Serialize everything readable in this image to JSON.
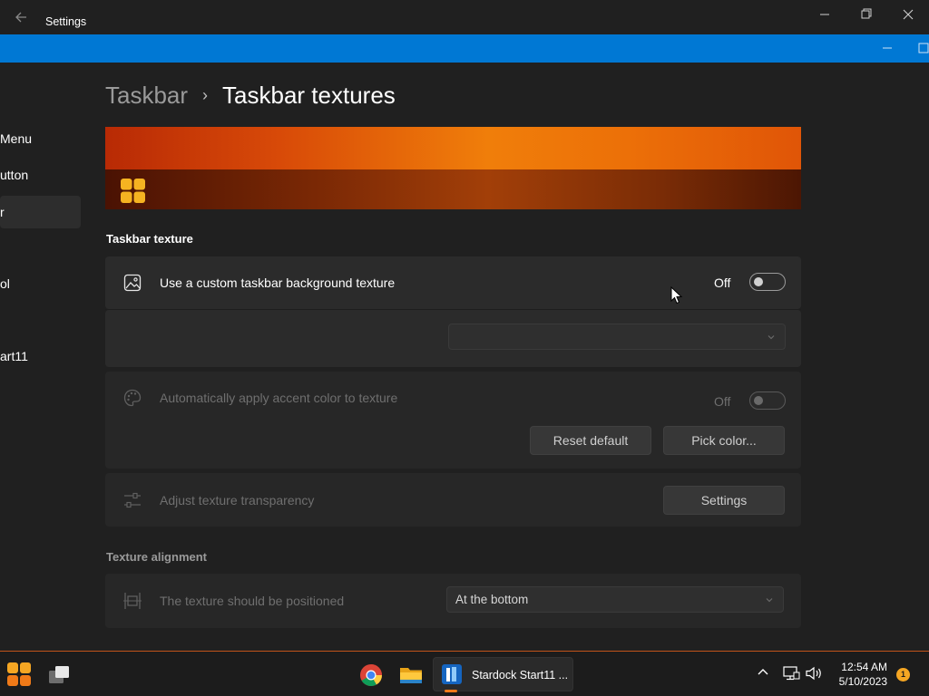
{
  "window": {
    "title": "Settings"
  },
  "sidebar": {
    "items": [
      {
        "label": "Menu"
      },
      {
        "label": "utton"
      },
      {
        "label": "r"
      },
      {
        "label": "ol"
      },
      {
        "label": "art11"
      }
    ]
  },
  "breadcrumb": {
    "parent": "Taskbar",
    "separator": "›",
    "current": "Taskbar textures"
  },
  "sections": {
    "texture_title": "Taskbar texture",
    "alignment_title": "Texture alignment"
  },
  "rows": {
    "custom_texture": {
      "label": "Use a custom taskbar background texture",
      "toggle_text": "Off",
      "toggle_on": false
    },
    "texture_select": {
      "value": ""
    },
    "accent": {
      "label": "Automatically apply accent color to texture",
      "toggle_text": "Off",
      "toggle_on": false
    },
    "reset_button": "Reset default",
    "pick_color_button": "Pick color...",
    "transparency": {
      "label": "Adjust texture transparency",
      "button": "Settings"
    },
    "position": {
      "label": "The texture should be positioned",
      "value": "At the bottom"
    }
  },
  "taskbar": {
    "active_app": "Stardock Start11 ...",
    "time": "12:54 AM",
    "date": "5/10/2023",
    "notifications": "1"
  },
  "colors": {
    "accent_blue": "#0078d4",
    "preview_orange": "#f07e0a",
    "taskbar_indicator": "#f07a18"
  }
}
